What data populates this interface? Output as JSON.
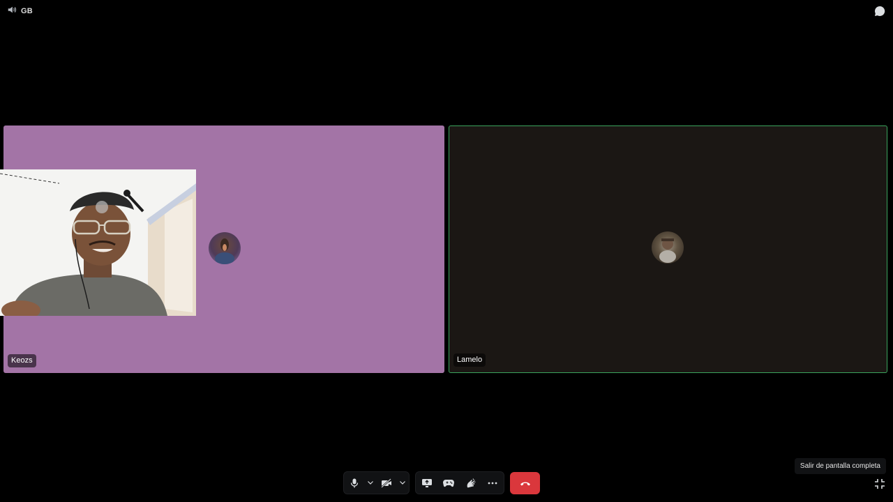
{
  "topbar": {
    "server_label": "GB",
    "icons": {
      "volume": "speaker-icon",
      "chat": "chat-bubble-icon"
    }
  },
  "tiles": [
    {
      "username": "Keozs",
      "background": "#a374a6",
      "avatar": "avatar-keozs",
      "camera_preview": true
    },
    {
      "username": "Lamelo",
      "background": "#1b1714",
      "speaking_border": "#3ba55d",
      "avatar": "avatar-lamelo"
    }
  ],
  "controls": {
    "groups": [
      [
        "microphone-icon",
        "chevron-down-icon",
        "camera-off-icon",
        "chevron-down-icon"
      ],
      [
        "screen-share-icon",
        "gamepad-icon",
        "soundboard-icon",
        "more-icon"
      ]
    ],
    "hangup": "phone-hangup-icon"
  },
  "tooltip": {
    "text": "Salir de pantalla completa"
  },
  "colors": {
    "accent_green": "#3ba55d",
    "danger": "#da373c",
    "control_bg": "#111214"
  }
}
